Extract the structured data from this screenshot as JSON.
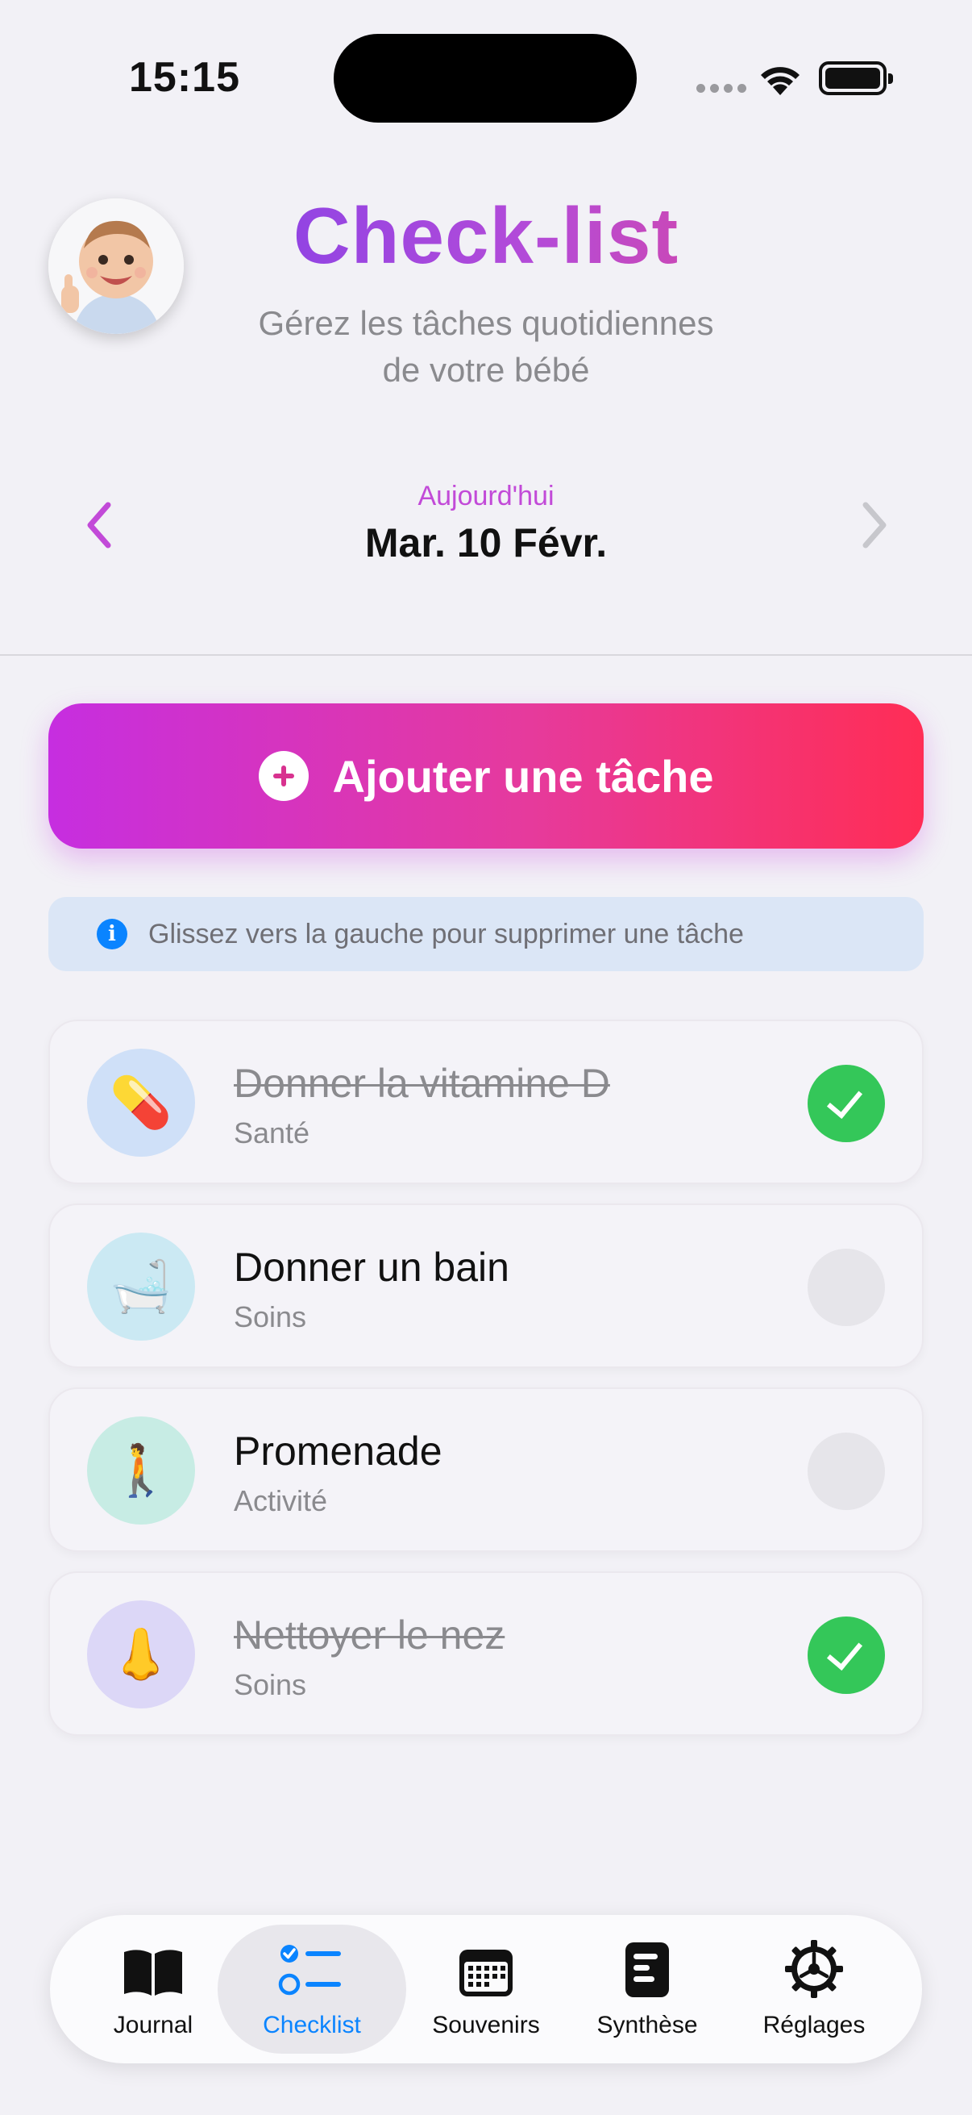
{
  "status_bar": {
    "time": "15:15"
  },
  "header": {
    "title": "Check-list",
    "subtitle_line1": "Gérez les tâches quotidiennes",
    "subtitle_line2": "de votre bébé"
  },
  "date_nav": {
    "today_label": "Aujourd'hui",
    "date": "Mar. 10 Févr."
  },
  "add_button": {
    "label": "Ajouter une tâche"
  },
  "hint": {
    "text": "Glissez vers la gauche pour supprimer une tâche"
  },
  "tasks": [
    {
      "title": "Donner la vitamine D",
      "category": "Santé",
      "done": true,
      "icon": "pill-icon",
      "emoji": "💊",
      "color": "#cfe0f8"
    },
    {
      "title": "Donner un bain",
      "category": "Soins",
      "done": false,
      "icon": "bathtub-icon",
      "emoji": "🛁",
      "color": "#cbe9f3"
    },
    {
      "title": "Promenade",
      "category": "Activité",
      "done": false,
      "icon": "walking-icon",
      "emoji": "🚶",
      "color": "#c7ece4"
    },
    {
      "title": "Nettoyer le nez",
      "category": "Soins",
      "done": true,
      "icon": "nose-icon",
      "emoji": "👃",
      "color": "#dcd7f7"
    }
  ],
  "tab_bar": {
    "active": "Checklist",
    "tabs": [
      {
        "label": "Journal",
        "icon": "book-icon"
      },
      {
        "label": "Checklist",
        "icon": "checklist-icon"
      },
      {
        "label": "Souvenirs",
        "icon": "calendar-icon"
      },
      {
        "label": "Synthèse",
        "icon": "report-icon"
      },
      {
        "label": "Réglages",
        "icon": "gear-icon"
      }
    ]
  },
  "colors": {
    "accent": "#c62ee0",
    "accent_end": "#ff2d55",
    "success": "#34c759",
    "tab_active": "#0a84ff"
  }
}
